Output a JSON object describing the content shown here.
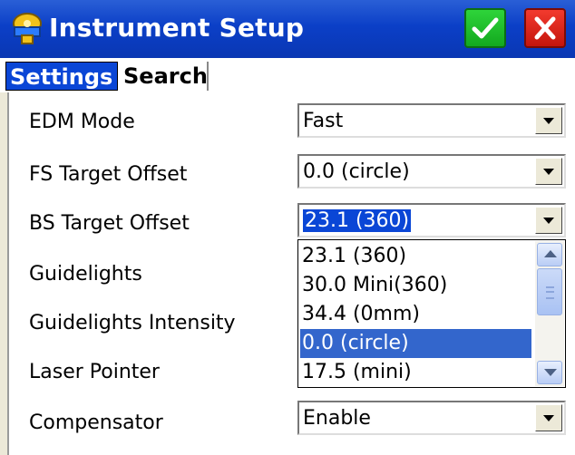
{
  "window": {
    "title": "Instrument Setup",
    "ok_icon": "check-icon",
    "close_icon": "close-icon"
  },
  "tabs": [
    {
      "label": "Settings",
      "active": true
    },
    {
      "label": "Search",
      "active": false
    }
  ],
  "fields": {
    "edm_mode": {
      "label": "EDM Mode",
      "value": "Fast"
    },
    "fs_target_offset": {
      "label": "FS Target Offset",
      "value": "0.0 (circle)"
    },
    "bs_target_offset": {
      "label": "BS Target Offset",
      "value": "23.1 (360)"
    },
    "guidelights": {
      "label": "Guidelights"
    },
    "guidelights_intensity": {
      "label": "Guidelights Intensity"
    },
    "laser_pointer": {
      "label": "Laser Pointer"
    },
    "compensator": {
      "label": "Compensator",
      "value": "Enable"
    }
  },
  "dropdown": {
    "options": [
      "23.1 (360)",
      "30.0 Mini(360)",
      "34.4 (0mm)",
      "0.0 (circle)",
      "17.5 (mini)"
    ],
    "highlighted": "0.0 (circle)"
  },
  "colors": {
    "titlebar": "#0b3fc7",
    "selection": "#0a46d6",
    "ok": "#13a81f",
    "close": "#c4150c"
  }
}
